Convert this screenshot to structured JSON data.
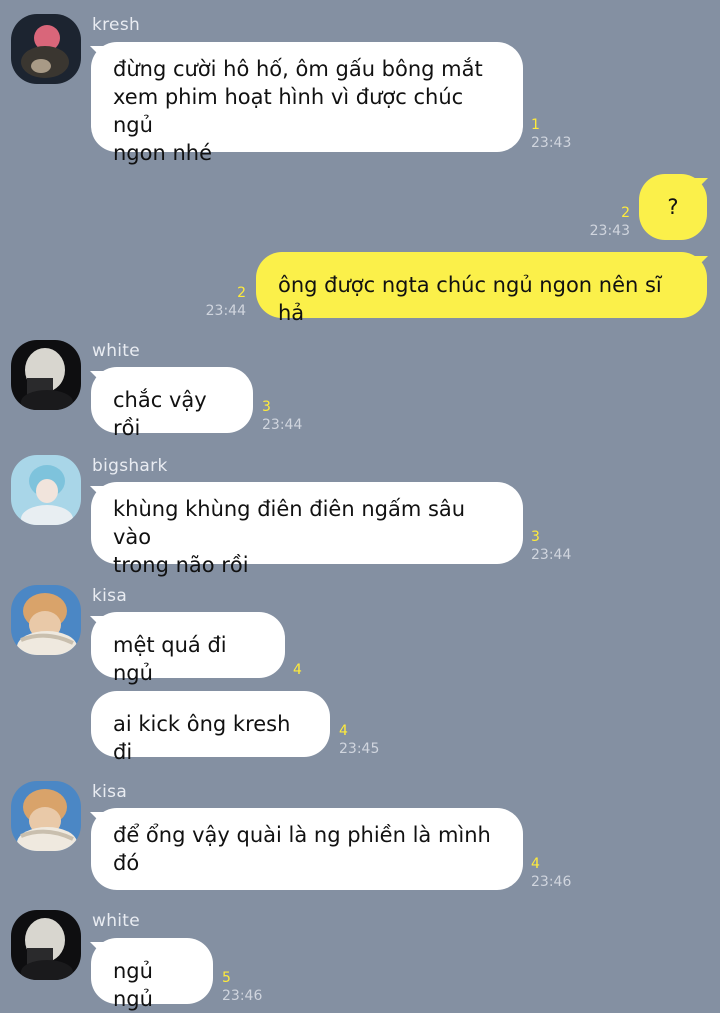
{
  "messages": [
    {
      "sender": "kresh",
      "text": "đừng cười hô hố, ôm gấu bông mắt\nxem phim hoạt hình vì được chúc ngủ\nngon nhé",
      "count": "1",
      "time": "23:43"
    },
    {
      "sender": "",
      "text": "?",
      "count": "2",
      "time": "23:43"
    },
    {
      "sender": "",
      "text": "ông được ngta chúc ngủ ngon nên sĩ hả",
      "count": "2",
      "time": "23:44"
    },
    {
      "sender": "white",
      "text": "chắc vậy rồi",
      "count": "3",
      "time": "23:44"
    },
    {
      "sender": "bigshark",
      "text": "khùng khùng điên điên ngấm sâu vào\ntrong não rồi",
      "count": "3",
      "time": "23:44"
    },
    {
      "sender": "kisa",
      "text": "mệt quá đi ngủ",
      "count": "4",
      "time": ""
    },
    {
      "sender": "",
      "text": "ai kick ông kresh đi",
      "count": "4",
      "time": "23:45"
    },
    {
      "sender": "kisa",
      "text": "để ổng vậy quài là ng phiền là mình\nđó",
      "count": "4",
      "time": "23:46"
    },
    {
      "sender": "white",
      "text": "ngủ ngủ",
      "count": "5",
      "time": "23:46"
    }
  ],
  "colors": {
    "background": "#8490a2",
    "incoming": "#ffffff",
    "outgoing": "#fbf04a",
    "unread": "#ffeb3b"
  }
}
